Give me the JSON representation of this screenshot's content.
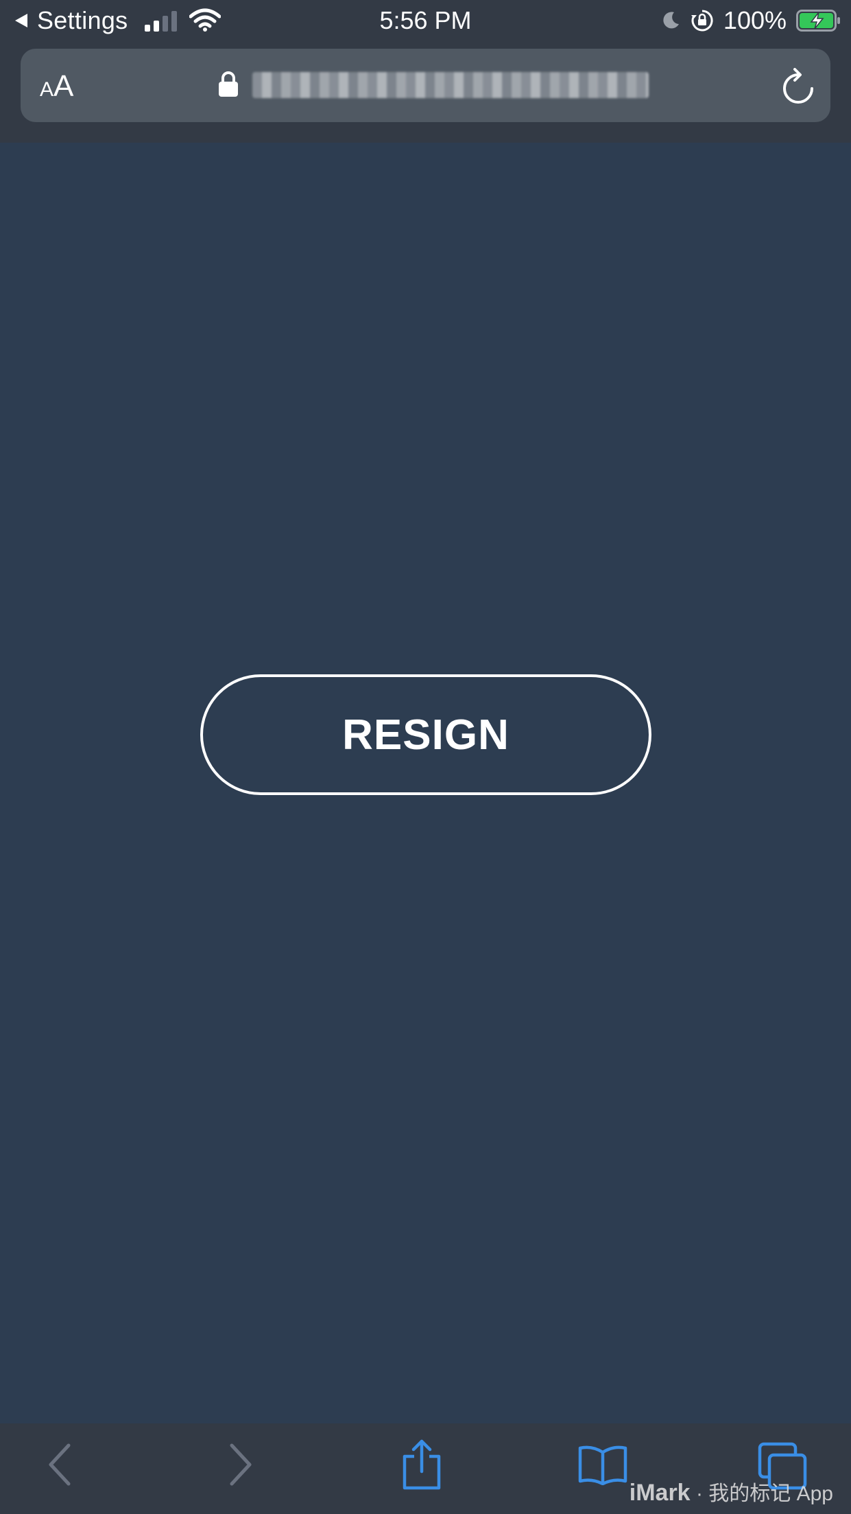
{
  "status_bar": {
    "back_label": "Settings",
    "time": "5:56 PM",
    "battery_percent": "100%",
    "icons": [
      "back-arrow-icon",
      "cellular-signal-icon",
      "wifi-icon",
      "moon-icon",
      "orientation-lock-icon",
      "battery-charging-icon"
    ]
  },
  "address_bar": {
    "text_size_label_small": "A",
    "text_size_label_large": "A",
    "url_blurred": true,
    "icons": [
      "lock-icon",
      "reload-icon"
    ]
  },
  "main": {
    "resign_label": "RESIGN"
  },
  "toolbar": {
    "icons": [
      "back-icon",
      "forward-icon",
      "share-icon",
      "bookmarks-icon",
      "tabs-icon"
    ]
  },
  "watermark": {
    "brand": "iMark",
    "separator": "·",
    "text": "我的标记 App"
  },
  "colors": {
    "page_background": "#2d3d51",
    "chrome_background": "#333a45",
    "address_field": "#505963",
    "toolbar_accent": "#3a8ee6",
    "toolbar_disabled": "#6b7280",
    "battery_green": "#34c759",
    "text": "#ffffff"
  }
}
